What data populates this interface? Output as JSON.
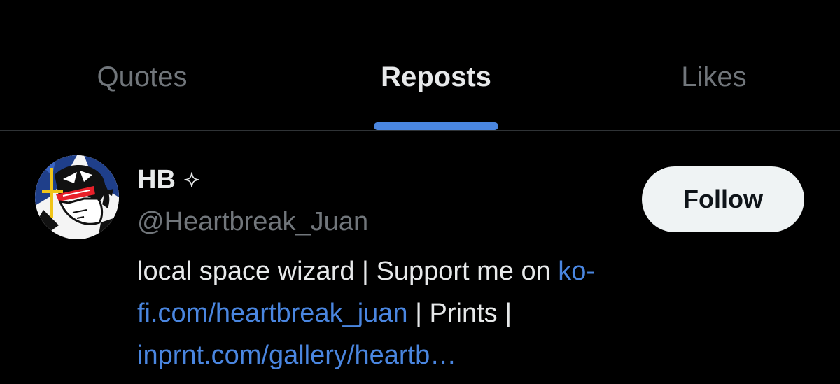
{
  "tabs": [
    {
      "label": "Quotes",
      "active": false
    },
    {
      "label": "Reposts",
      "active": true
    },
    {
      "label": "Likes",
      "active": false
    }
  ],
  "colors": {
    "background": "#000000",
    "accent": "#4a86e0",
    "link": "#4a86e0",
    "text_primary": "#e7e9ea",
    "text_secondary": "#71767b",
    "divider": "#2f3336",
    "follow_bg": "#eff3f4",
    "follow_text": "#0f1419"
  },
  "user": {
    "display_name": "HB",
    "name_icon": "sparkle-icon",
    "handle": "@Heartbreak_Juan",
    "avatar_icon": "avatar-illustration",
    "follow_label": "Follow",
    "bio": {
      "line1_text": "local space wizard | Support me on ",
      "line1_link": "ko-",
      "line2_link": "fi.com/heartbreak_juan",
      "line2_text": " | Prints |",
      "line3_link": "inprnt.com/gallery/heartb…"
    }
  }
}
